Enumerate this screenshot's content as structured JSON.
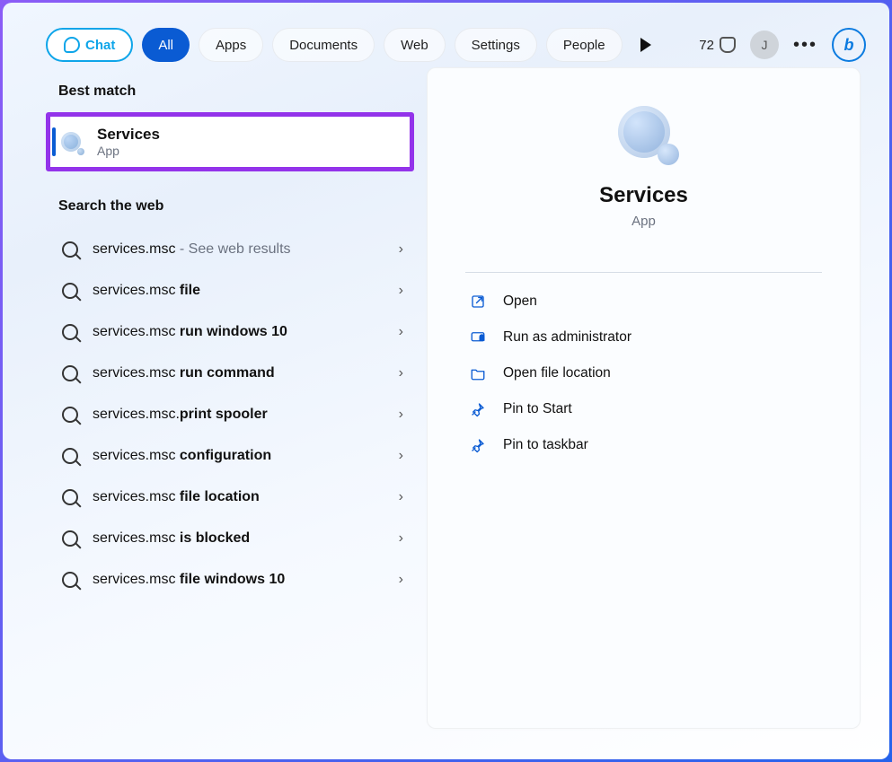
{
  "colors": {
    "accent": "#0a5bd3",
    "highlight_border": "#9333ea"
  },
  "topbar": {
    "chat_label": "Chat",
    "tabs": [
      "All",
      "Apps",
      "Documents",
      "Web",
      "Settings",
      "People"
    ],
    "active_tab_index": 0,
    "points": "72",
    "avatar_initial": "J"
  },
  "left": {
    "best_match_header": "Best match",
    "best_match": {
      "title": "Services",
      "subtitle": "App"
    },
    "web_header": "Search the web",
    "web_results": [
      {
        "plain": "services.msc",
        "bold": "",
        "suffix": " - See web results"
      },
      {
        "plain": "services.msc ",
        "bold": "file",
        "suffix": ""
      },
      {
        "plain": "services.msc ",
        "bold": "run windows 10",
        "suffix": ""
      },
      {
        "plain": "services.msc ",
        "bold": "run command",
        "suffix": ""
      },
      {
        "plain": "services.msc.",
        "bold": "print spooler",
        "suffix": ""
      },
      {
        "plain": "services.msc ",
        "bold": "configuration",
        "suffix": ""
      },
      {
        "plain": "services.msc ",
        "bold": "file location",
        "suffix": ""
      },
      {
        "plain": "services.msc ",
        "bold": "is blocked",
        "suffix": ""
      },
      {
        "plain": "services.msc ",
        "bold": "file windows 10",
        "suffix": ""
      }
    ]
  },
  "right": {
    "title": "Services",
    "subtitle": "App",
    "actions": [
      {
        "icon": "open",
        "label": "Open"
      },
      {
        "icon": "shield",
        "label": "Run as administrator"
      },
      {
        "icon": "folder",
        "label": "Open file location"
      },
      {
        "icon": "pin",
        "label": "Pin to Start"
      },
      {
        "icon": "pin",
        "label": "Pin to taskbar"
      }
    ]
  }
}
